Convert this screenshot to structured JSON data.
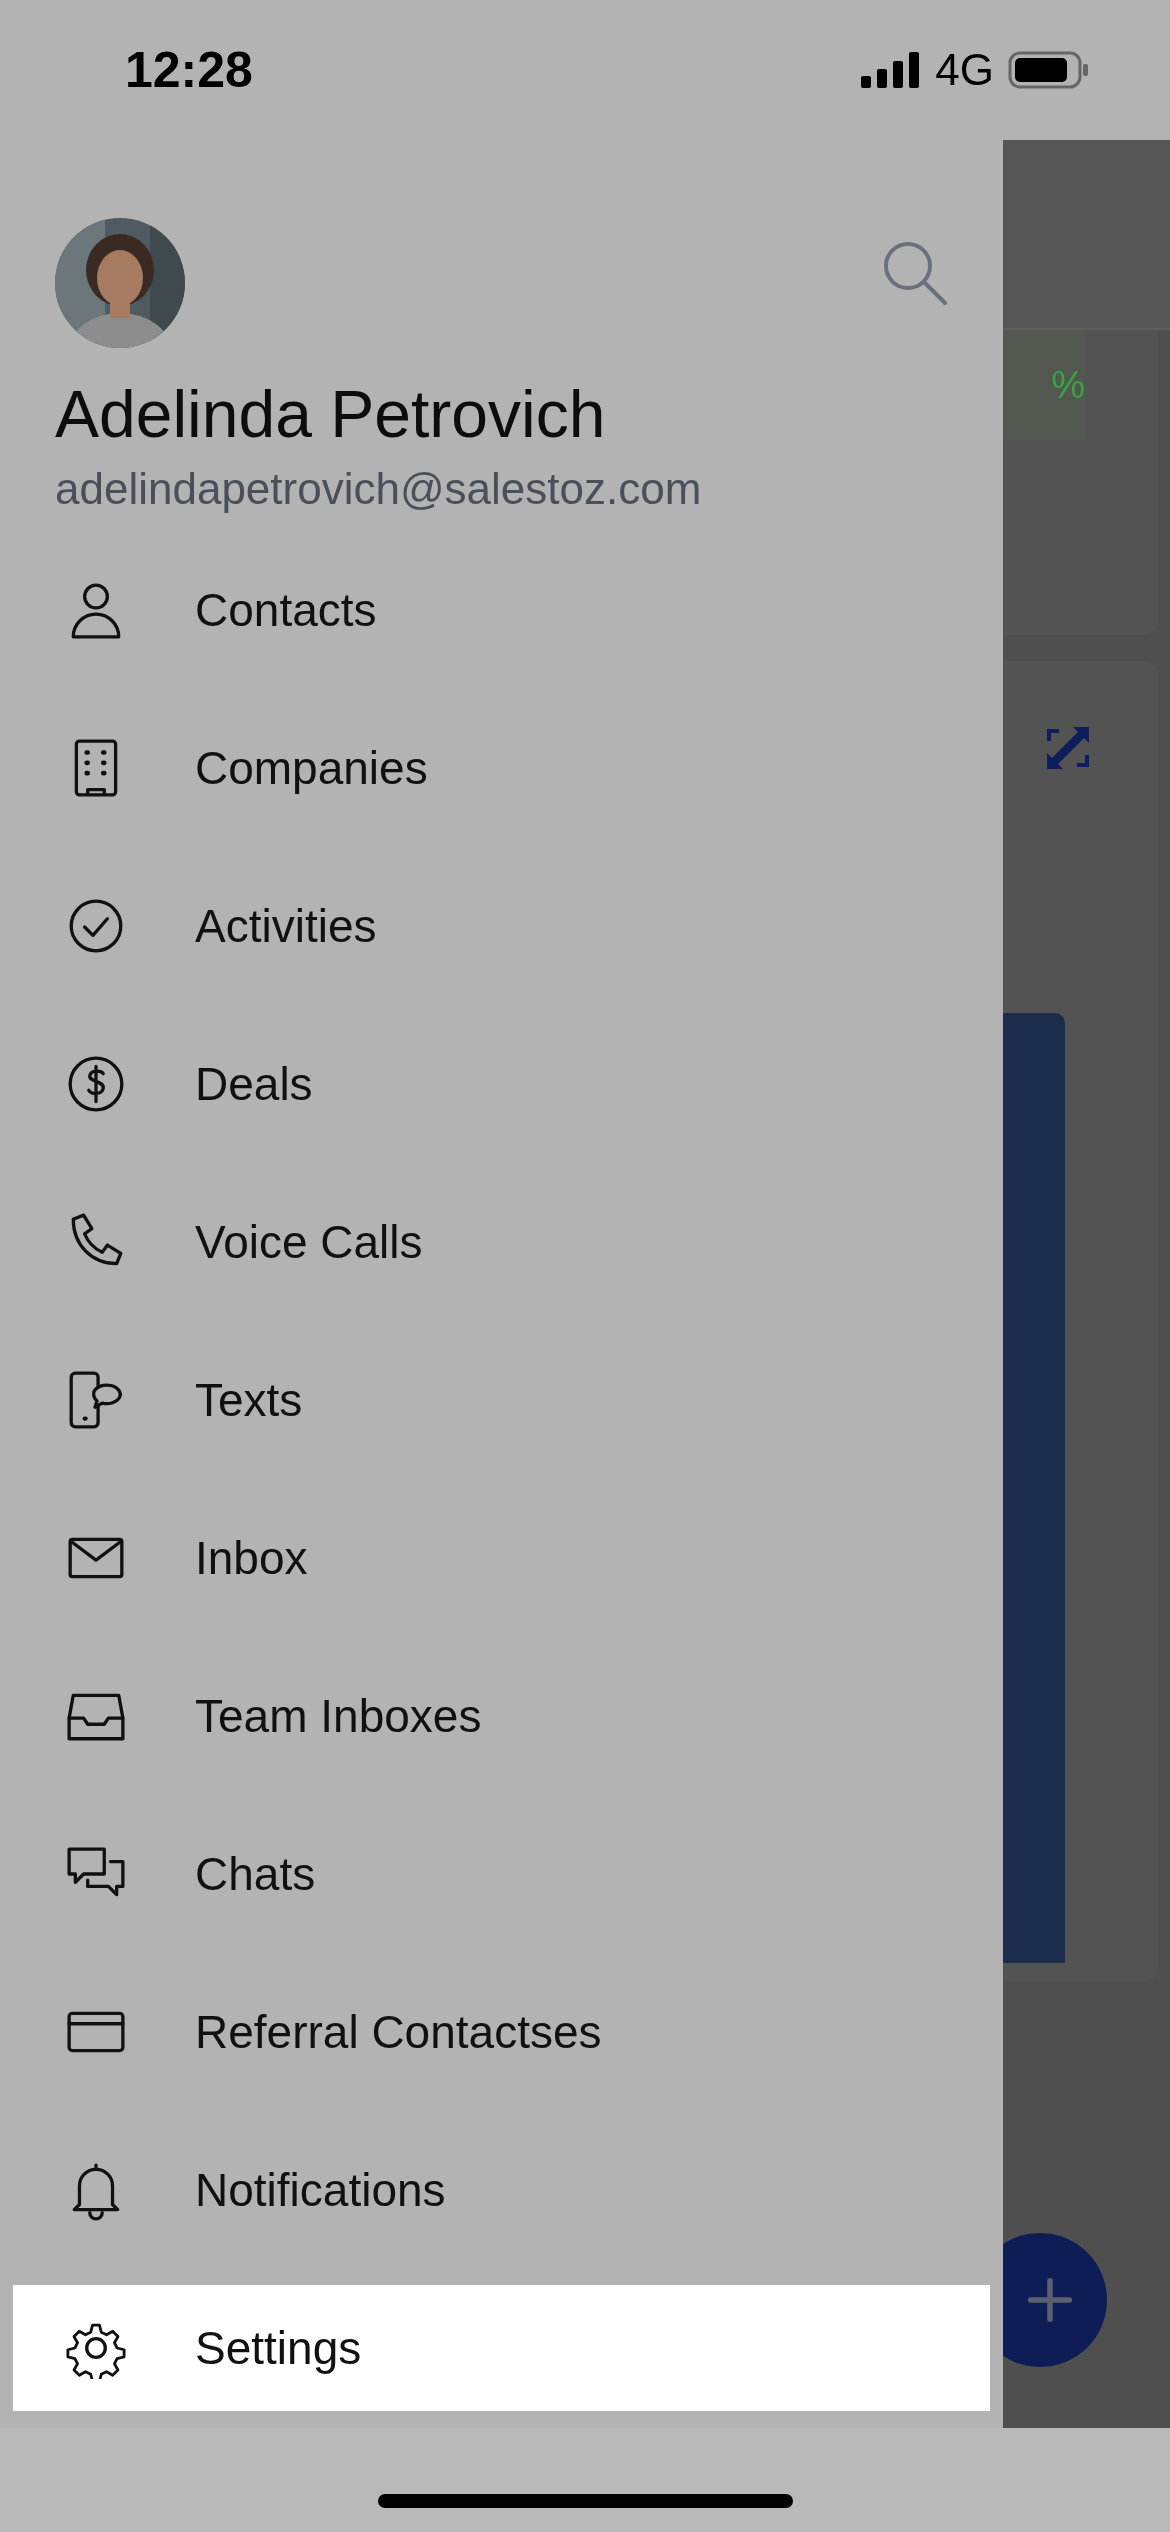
{
  "status_bar": {
    "time": "12:28",
    "network": "4G"
  },
  "profile": {
    "name": "Adelinda Petrovich",
    "email": "adelindapetrovich@salestoz.com"
  },
  "menu": [
    {
      "label": "Contacts",
      "selected": false
    },
    {
      "label": "Companies",
      "selected": false
    },
    {
      "label": "Activities",
      "selected": false
    },
    {
      "label": "Deals",
      "selected": false
    },
    {
      "label": "Voice Calls",
      "selected": false
    },
    {
      "label": "Texts",
      "selected": false
    },
    {
      "label": "Inbox",
      "selected": false
    },
    {
      "label": "Team Inboxes",
      "selected": false
    },
    {
      "label": "Chats",
      "selected": false
    },
    {
      "label": "Referral Contactses",
      "selected": false
    },
    {
      "label": "Notifications",
      "selected": false
    },
    {
      "label": "Settings",
      "selected": true
    }
  ],
  "background_screen": {
    "partial_text": "%"
  }
}
